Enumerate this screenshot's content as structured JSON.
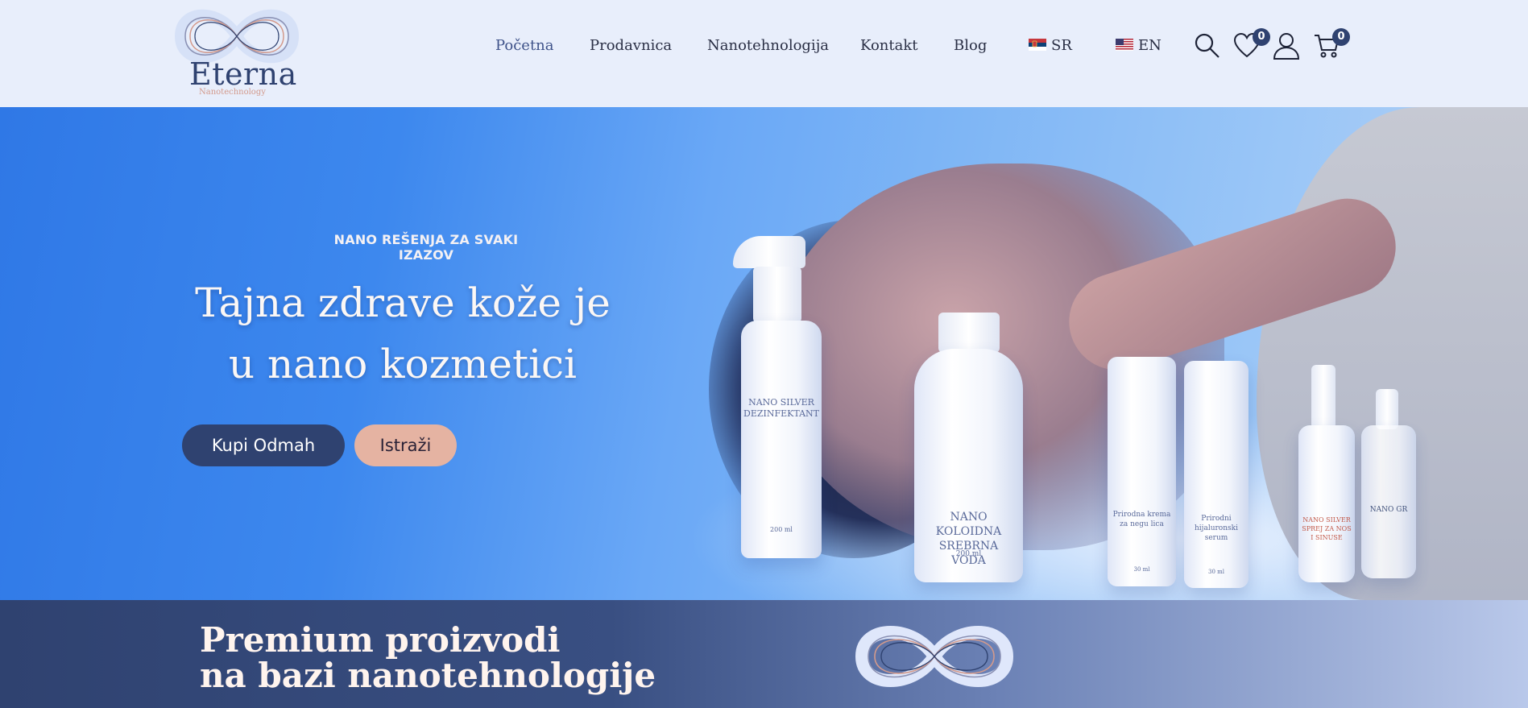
{
  "brand": {
    "name": "Eterna",
    "tagline": "Nanotechnology"
  },
  "nav": {
    "items": [
      {
        "label": "Početna",
        "active": true
      },
      {
        "label": "Prodavnica"
      },
      {
        "label": "Nanotehnologija"
      },
      {
        "label": "Kontakt"
      },
      {
        "label": "Blog"
      }
    ],
    "languages": [
      {
        "code": "SR",
        "flag": "serbia-flag-icon"
      },
      {
        "code": "EN",
        "flag": "usa-flag-icon"
      }
    ]
  },
  "header_icons": {
    "search": "search-icon",
    "wishlist": {
      "icon": "heart-icon",
      "count": "0"
    },
    "account": "user-icon",
    "cart": {
      "icon": "cart-icon",
      "count": "0"
    }
  },
  "hero": {
    "kicker": "NANO REŠENJA ZA SVAKI IZAZOV",
    "title": "Tajna zdrave kože je u nano kozmetici",
    "primary_button": "Kupi Odmah",
    "secondary_button": "Istraži",
    "products": [
      {
        "label": "NANO SILVER DEZINFEKTANT",
        "sub": "200 ml"
      },
      {
        "label": "NANO KOLOIDNA SREBRNA VODA",
        "sub": "200 ml"
      },
      {
        "label": "Prirodna krema za negu lica",
        "sub": "30 ml"
      },
      {
        "label": "Prirodni hijaluronski serum",
        "sub": "30 ml"
      },
      {
        "label": "NANO SILVER SPREJ ZA NOS I SINUSE",
        "sub": ""
      },
      {
        "label": "NANO GR",
        "sub": ""
      }
    ]
  },
  "band": {
    "title_line1": "Premium proizvodi",
    "title_line2": "na bazi nanotehnologije"
  },
  "colors": {
    "brand_navy": "#2f4270",
    "brand_peach": "#e5b3a2",
    "header_bg": "#e8eefb",
    "hero_blue": "#3d88ee"
  }
}
